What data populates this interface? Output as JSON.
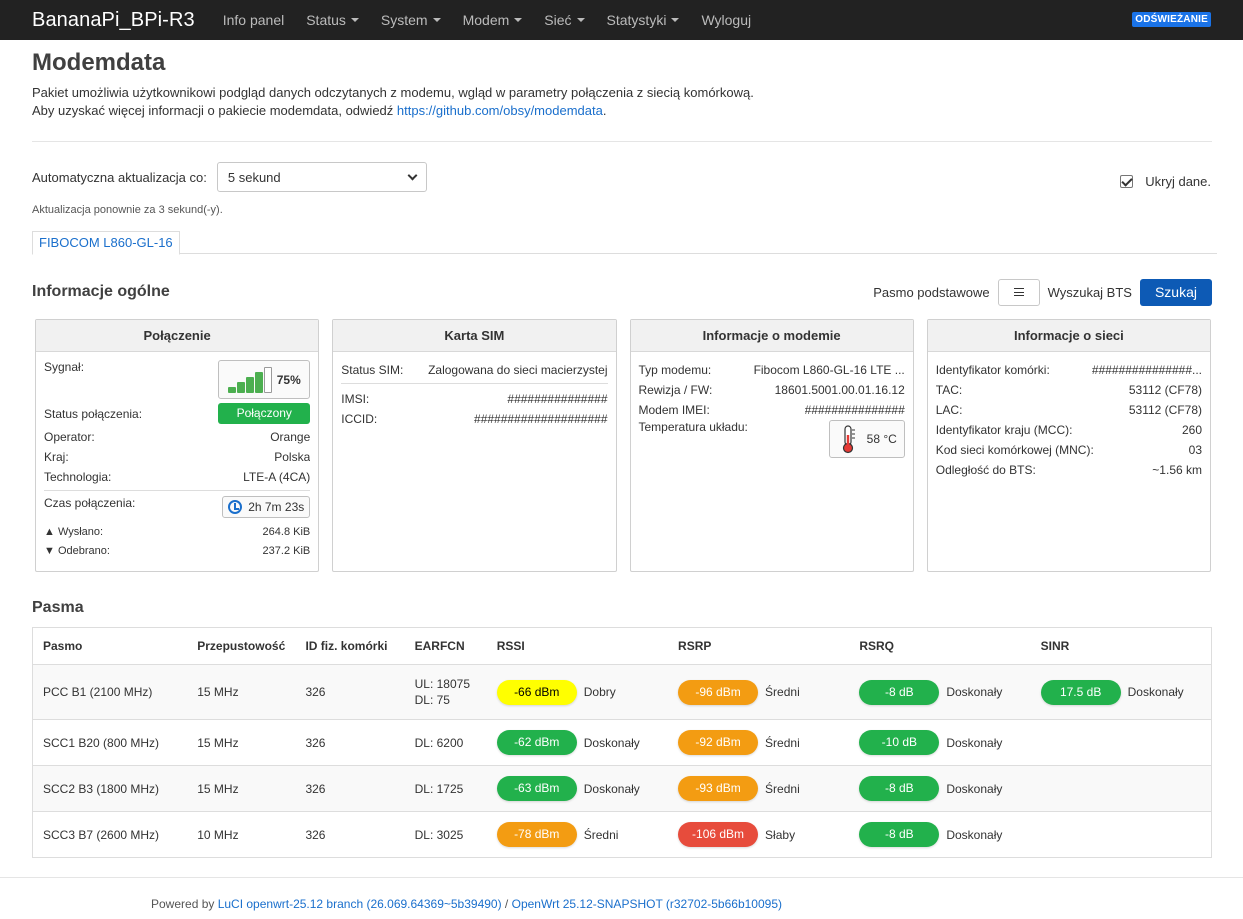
{
  "nav": {
    "brand": "BananaPi_BPi-R3",
    "items": [
      {
        "label": "Info panel",
        "caret": false
      },
      {
        "label": "Status",
        "caret": true
      },
      {
        "label": "System",
        "caret": true
      },
      {
        "label": "Modem",
        "caret": true
      },
      {
        "label": "Sieć",
        "caret": true
      },
      {
        "label": "Statystyki",
        "caret": true
      },
      {
        "label": "Wyloguj",
        "caret": false
      }
    ],
    "refresh_badge": "ODŚWIEŻANIE"
  },
  "page": {
    "title": "Modemdata",
    "desc_line1": "Pakiet umożliwia użytkownikowi podgląd danych odczytanych z modemu, wgląd w parametry połączenia z siecią komórkową.",
    "desc_line2_prefix": "Aby uzyskać więcej informacji o pakiecie modemdata, odwiedź ",
    "desc_link": "https://github.com/obsy/modemdata",
    "desc_line2_suffix": "."
  },
  "controls": {
    "auto_update_label": "Automatyczna aktualizacja co:",
    "auto_update_value": "5 sekund",
    "hide_data_label": "Ukryj dane.",
    "hide_data_checked": true,
    "update_countdown": "Aktualizacja ponownie za 3 sekund(-y)."
  },
  "tab": {
    "label": "FIBOCOM L860-GL-16"
  },
  "general": {
    "title": "Informacje ogólne",
    "base_band_label": "Pasmo podstawowe",
    "search_bts_label": "Wyszukaj BTS",
    "search_button": "Szukaj"
  },
  "connection": {
    "title": "Połączenie",
    "signal_label": "Sygnał:",
    "signal_percent": "75%",
    "signal_level": 0.75,
    "status_label": "Status połączenia:",
    "status_value": "Połączony",
    "operator_label": "Operator:",
    "operator_value": "Orange",
    "country_label": "Kraj:",
    "country_value": "Polska",
    "tech_label": "Technologia:",
    "tech_value": "LTE-A (4CA)",
    "conn_time_label": "Czas połączenia:",
    "conn_time_value": "2h 7m 23s",
    "sent_label": "▲ Wysłano:",
    "sent_value": "264.8 KiB",
    "received_label": "▼ Odebrano:",
    "received_value": "237.2 KiB"
  },
  "sim": {
    "title": "Karta SIM",
    "status_label": "Status SIM:",
    "status_value": "Zalogowana do sieci macierzystej",
    "imsi_label": "IMSI:",
    "imsi_value": "###############",
    "iccid_label": "ICCID:",
    "iccid_value": "####################"
  },
  "modem": {
    "title": "Informacje o modemie",
    "type_label": "Typ modemu:",
    "type_value": "Fibocom L860-GL-16 LTE ...",
    "fw_label": "Rewizja / FW:",
    "fw_value": "18601.5001.00.01.16.12",
    "imei_label": "Modem IMEI:",
    "imei_value": "###############",
    "temp_label": "Temperatura układu:",
    "temp_value": "58 °C"
  },
  "network": {
    "title": "Informacje o sieci",
    "cell_id_label": "Identyfikator komórki:",
    "cell_id_value": "###############...",
    "tac_label": "TAC:",
    "tac_value": "53112 (CF78)",
    "lac_label": "LAC:",
    "lac_value": "53112 (CF78)",
    "mcc_label": "Identyfikator kraju (MCC):",
    "mcc_value": "260",
    "mnc_label": "Kod sieci komórkowej (MNC):",
    "mnc_value": "03",
    "bts_dist_label": "Odległość do BTS:",
    "bts_dist_value": "~1.56 km"
  },
  "bands": {
    "title": "Pasma",
    "headers": [
      "Pasmo",
      "Przepustowość",
      "ID fiz. komórki",
      "EARFCN",
      "RSSI",
      "RSRP",
      "RSRQ",
      "SINR"
    ],
    "rows": [
      {
        "band": "PCC B1 (2100 MHz)",
        "bw": "15 MHz",
        "pci": "326",
        "earfcn_ul": "UL: 18075",
        "earfcn_dl": "DL: 75",
        "rssi": "-66 dBm",
        "rssi_q": "Dobry",
        "rssi_c": "q-good",
        "rsrp": "-96 dBm",
        "rsrp_q": "Średni",
        "rsrp_c": "q-medium",
        "rsrq": "-8 dB",
        "rsrq_q": "Doskonały",
        "rsrq_c": "q-excellent",
        "sinr": "17.5 dB",
        "sinr_q": "Doskonały",
        "sinr_c": "q-excellent"
      },
      {
        "band": "SCC1 B20 (800 MHz)",
        "bw": "15 MHz",
        "pci": "326",
        "earfcn_ul": "",
        "earfcn_dl": "DL: 6200",
        "rssi": "-62 dBm",
        "rssi_q": "Doskonały",
        "rssi_c": "q-excellent",
        "rsrp": "-92 dBm",
        "rsrp_q": "Średni",
        "rsrp_c": "q-medium",
        "rsrq": "-10 dB",
        "rsrq_q": "Doskonały",
        "rsrq_c": "q-excellent",
        "sinr": "",
        "sinr_q": "",
        "sinr_c": ""
      },
      {
        "band": "SCC2 B3 (1800 MHz)",
        "bw": "15 MHz",
        "pci": "326",
        "earfcn_ul": "",
        "earfcn_dl": "DL: 1725",
        "rssi": "-63 dBm",
        "rssi_q": "Doskonały",
        "rssi_c": "q-excellent",
        "rsrp": "-93 dBm",
        "rsrp_q": "Średni",
        "rsrp_c": "q-medium",
        "rsrq": "-8 dB",
        "rsrq_q": "Doskonały",
        "rsrq_c": "q-excellent",
        "sinr": "",
        "sinr_q": "",
        "sinr_c": ""
      },
      {
        "band": "SCC3 B7 (2600 MHz)",
        "bw": "10 MHz",
        "pci": "326",
        "earfcn_ul": "",
        "earfcn_dl": "DL: 3025",
        "rssi": "-78 dBm",
        "rssi_q": "Średni",
        "rssi_c": "q-medium",
        "rsrp": "-106 dBm",
        "rsrp_q": "Słaby",
        "rsrp_c": "q-weak",
        "rsrq": "-8 dB",
        "rsrq_q": "Doskonały",
        "rsrq_c": "q-excellent",
        "sinr": "",
        "sinr_q": "",
        "sinr_c": ""
      }
    ]
  },
  "footer": {
    "prefix": "Powered by ",
    "luci_link": "LuCI openwrt-25.12 branch (26.069.64369~5b39490)",
    "sep": " / ",
    "openwrt_link": "OpenWrt 25.12-SNAPSHOT (r32702-5b66b10095)"
  },
  "colors": {
    "navbar": "#222222",
    "accent": "#0d5ab5",
    "link": "#1a6fcc",
    "good": "#ffff00",
    "excellent": "#22b14c",
    "medium": "#f39c12",
    "weak": "#e74c3c"
  }
}
